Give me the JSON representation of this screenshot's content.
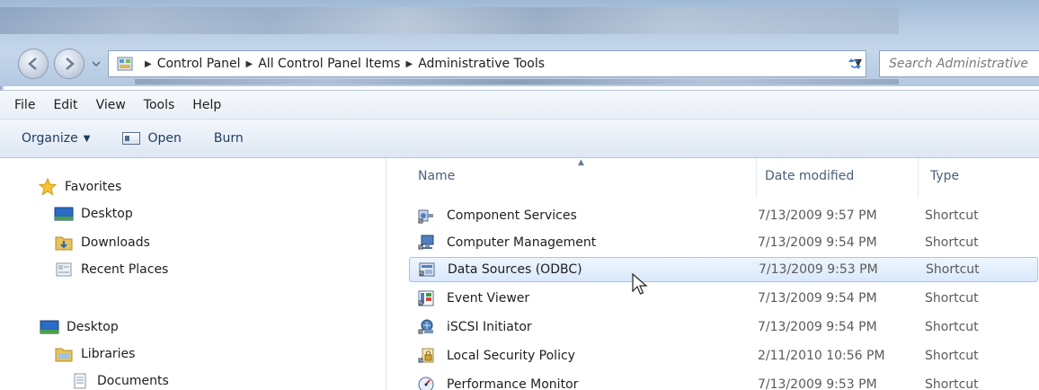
{
  "address": {
    "crumbs": [
      "Control Panel",
      "All Control Panel Items",
      "Administrative Tools"
    ],
    "search_placeholder": "Search Administrative"
  },
  "menu": [
    "File",
    "Edit",
    "View",
    "Tools",
    "Help"
  ],
  "commands": {
    "organize": "Organize",
    "open": "Open",
    "burn": "Burn"
  },
  "nav": {
    "favorites": "Favorites",
    "desktop": "Desktop",
    "downloads": "Downloads",
    "recent_places": "Recent Places",
    "desktop2": "Desktop",
    "libraries": "Libraries",
    "documents": "Documents"
  },
  "columns": {
    "name": "Name",
    "date_modified": "Date modified",
    "type": "Type"
  },
  "files": [
    {
      "name": "Component Services",
      "date": "7/13/2009 9:57 PM",
      "type": "Shortcut"
    },
    {
      "name": "Computer Management",
      "date": "7/13/2009 9:54 PM",
      "type": "Shortcut"
    },
    {
      "name": "Data Sources (ODBC)",
      "date": "7/13/2009 9:53 PM",
      "type": "Shortcut"
    },
    {
      "name": "Event Viewer",
      "date": "7/13/2009 9:54 PM",
      "type": "Shortcut"
    },
    {
      "name": "iSCSI Initiator",
      "date": "7/13/2009 9:54 PM",
      "type": "Shortcut"
    },
    {
      "name": "Local Security Policy",
      "date": "2/11/2010 10:56 PM",
      "type": "Shortcut"
    },
    {
      "name": "Performance Monitor",
      "date": "7/13/2009 9:53 PM",
      "type": "Shortcut"
    }
  ],
  "selected_file": "Data Sources (ODBC)",
  "colors": {
    "selection": "#d9e9fb",
    "selection_border": "#a3c4ea",
    "header_text": "#4c607a"
  }
}
